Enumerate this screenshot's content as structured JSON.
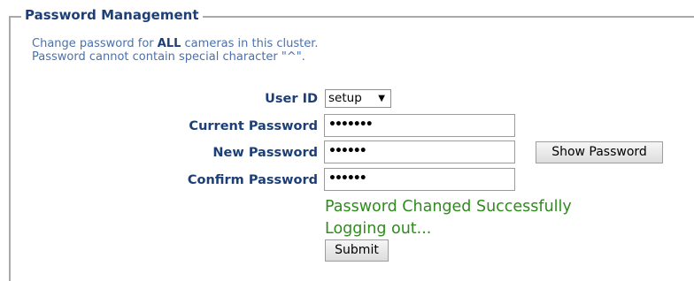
{
  "section": {
    "legend": "Password Management",
    "description_line1_prefix": "Change password for ",
    "description_line1_bold": "ALL",
    "description_line1_suffix": " cameras in this cluster.",
    "description_line2": "Password cannot contain special character \"^\"."
  },
  "form": {
    "user_id_label": "User ID",
    "user_id_value": "setup",
    "current_password_label": "Current Password",
    "current_password_value": "•••••••",
    "new_password_label": "New Password",
    "new_password_value": "••••••",
    "confirm_password_label": "Confirm Password",
    "confirm_password_value": "••••••",
    "show_password_label": "Show Password",
    "submit_label": "Submit"
  },
  "status": {
    "line1": "Password Changed Successfully",
    "line2": "Logging out..."
  },
  "colors": {
    "label": "#1d3f77",
    "description": "#4a70ad",
    "success": "#2e8b1c"
  },
  "icons": {
    "dropdown": "chevron-down-icon"
  }
}
